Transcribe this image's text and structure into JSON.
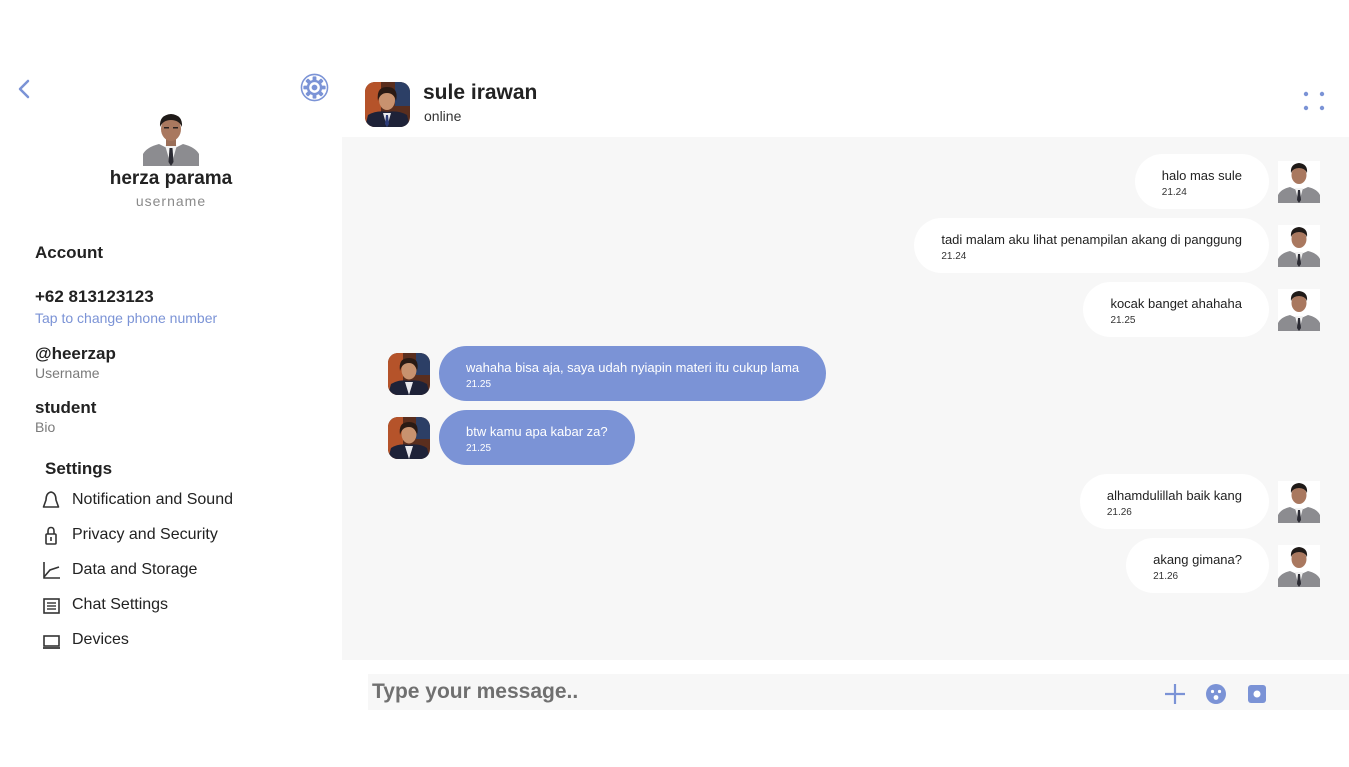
{
  "profile": {
    "name": "herza parama",
    "username_label": "username"
  },
  "account": {
    "heading": "Account",
    "phone": "+62 813123123",
    "phone_hint": "Tap to change phone number",
    "handle": "@heerzap",
    "handle_label": "Username",
    "bio": "student",
    "bio_label": "Bio"
  },
  "settings": {
    "heading": "Settings",
    "items": [
      {
        "label": "Notification and Sound",
        "icon": "bell-icon"
      },
      {
        "label": "Privacy and Security",
        "icon": "lock-icon"
      },
      {
        "label": "Data and Storage",
        "icon": "chart-icon"
      },
      {
        "label": "Chat Settings",
        "icon": "list-icon"
      },
      {
        "label": "Devices",
        "icon": "laptop-icon"
      }
    ]
  },
  "chat": {
    "contact_name": "sule irawan",
    "status": "online",
    "messages": [
      {
        "side": "out",
        "text": "halo mas sule",
        "time": "21.24"
      },
      {
        "side": "out",
        "text": "tadi malam aku lihat penampilan akang di panggung",
        "time": "21.24"
      },
      {
        "side": "out",
        "text": "kocak banget ahahaha",
        "time": "21.25"
      },
      {
        "side": "in",
        "text": "wahaha bisa aja, saya udah nyiapin materi itu cukup lama",
        "time": "21.25"
      },
      {
        "side": "in",
        "text": "btw kamu apa kabar za?",
        "time": "21.25"
      },
      {
        "side": "out",
        "text": "alhamdulillah baik kang",
        "time": "21.26"
      },
      {
        "side": "out",
        "text": "akang gimana?",
        "time": "21.26"
      }
    ]
  },
  "composer": {
    "placeholder": "Type your message.."
  },
  "colors": {
    "accent": "#7b93d6",
    "chat_background": "#f7f7f7",
    "outgoing_bubble": "#ffffff"
  }
}
